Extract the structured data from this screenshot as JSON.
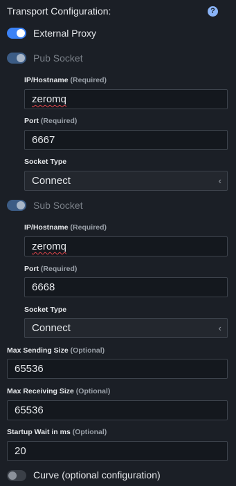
{
  "heading": "Transport Configuration:",
  "help_icon": "?",
  "external_proxy": {
    "label": "External Proxy",
    "enabled": true
  },
  "pub_socket": {
    "label": "Pub Socket",
    "enabled": true,
    "ip": {
      "label": "IP/Hostname",
      "hint": "(Required)",
      "value": "zeromq"
    },
    "port": {
      "label": "Port",
      "hint": "(Required)",
      "value": "6667"
    },
    "socket_type": {
      "label": "Socket Type",
      "value": "Connect"
    }
  },
  "sub_socket": {
    "label": "Sub Socket",
    "enabled": true,
    "ip": {
      "label": "IP/Hostname",
      "hint": "(Required)",
      "value": "zeromq"
    },
    "port": {
      "label": "Port",
      "hint": "(Required)",
      "value": "6668"
    },
    "socket_type": {
      "label": "Socket Type",
      "value": "Connect"
    }
  },
  "max_sending_size": {
    "label": "Max Sending Size",
    "hint": "(Optional)",
    "value": "65536"
  },
  "max_receiving_size": {
    "label": "Max Receiving Size",
    "hint": "(Optional)",
    "value": "65536"
  },
  "startup_wait": {
    "label": "Startup Wait in ms",
    "hint": "(Optional)",
    "value": "20"
  },
  "curve": {
    "label": "Curve (optional configuration)",
    "enabled": false
  },
  "icons": {
    "help": "question-circle-icon",
    "select_chevron": "chevron-left-icon"
  },
  "colors": {
    "background": "#1b1f26",
    "accent": "#3b82f6",
    "input_background": "#14181e",
    "spellcheck": "#e0454b"
  }
}
